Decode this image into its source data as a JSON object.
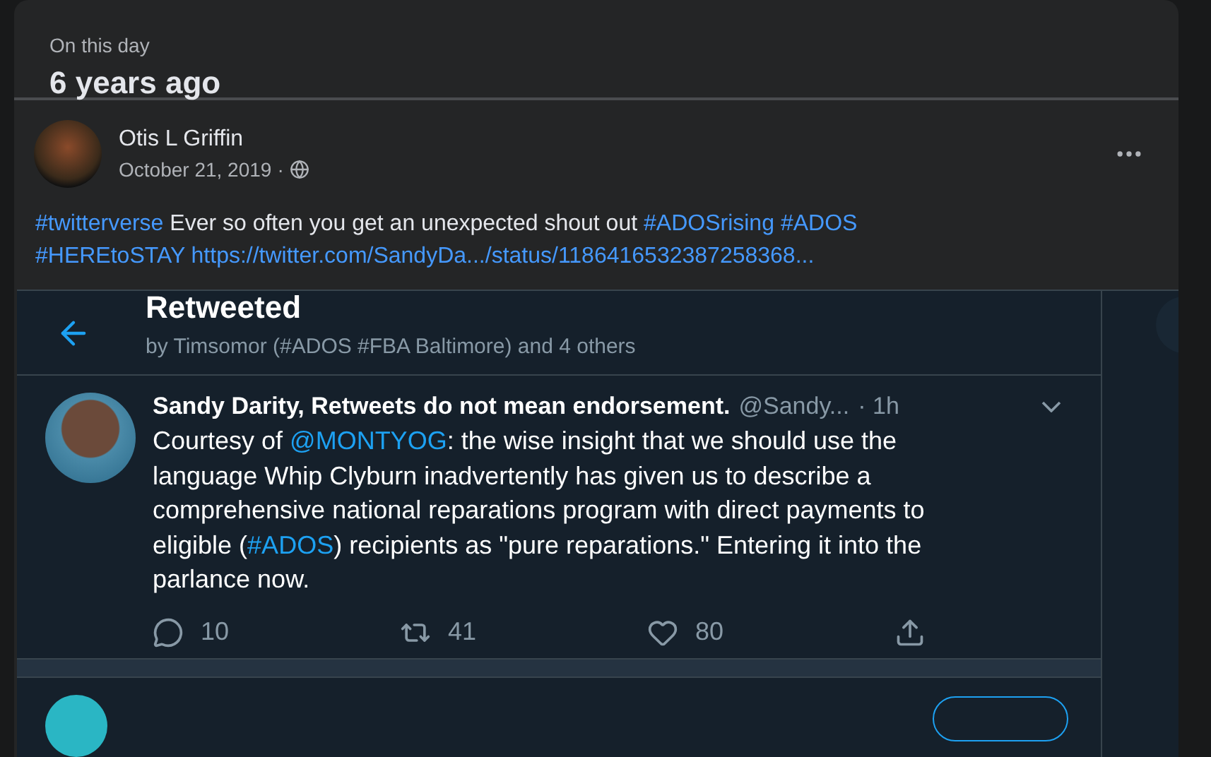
{
  "memory": {
    "label": "On this day",
    "title": "6 years ago"
  },
  "post": {
    "author": "Otis L Griffin",
    "date": "October 21, 2019",
    "separator": "·",
    "text": [
      {
        "kind": "link",
        "text": "#twitterverse"
      },
      {
        "kind": "text",
        "text": " Ever so often you get an unexpected shout out "
      },
      {
        "kind": "link",
        "text": "#ADOSrising"
      },
      {
        "kind": "link",
        "text": "#ADOS"
      },
      {
        "kind": "link",
        "text": "#HEREtoSTAY"
      },
      {
        "kind": "link",
        "text": "https://twitter.com/SandyDa.../status/1186416532387258368..."
      }
    ]
  },
  "embed": {
    "header": {
      "title": "Retweeted",
      "subtitle": "by Timsomor (#ADOS #FBA Baltimore) and 4 others"
    },
    "tweet": {
      "name": "Sandy Darity, Retweets do not mean endorsement.",
      "handle": "@Sandy...",
      "time": "· 1h",
      "text": [
        {
          "kind": "text",
          "text": "Courtesy of "
        },
        {
          "kind": "link",
          "text": "@MONTYOG"
        },
        {
          "kind": "text",
          "text": ": the wise insight that we should use the language Whip Clyburn inadvertently has given us to describe a comprehensive national reparations program with direct payments to eligible ("
        },
        {
          "kind": "link",
          "text": "#ADOS"
        },
        {
          "kind": "text",
          "text": ") recipients as \"pure reparations.\" Entering it into the parlance now."
        }
      ],
      "actions": [
        {
          "kind": "reply",
          "count": "10"
        },
        {
          "kind": "retweet",
          "count": "41"
        },
        {
          "kind": "like",
          "count": "80"
        },
        {
          "kind": "share"
        }
      ]
    }
  }
}
